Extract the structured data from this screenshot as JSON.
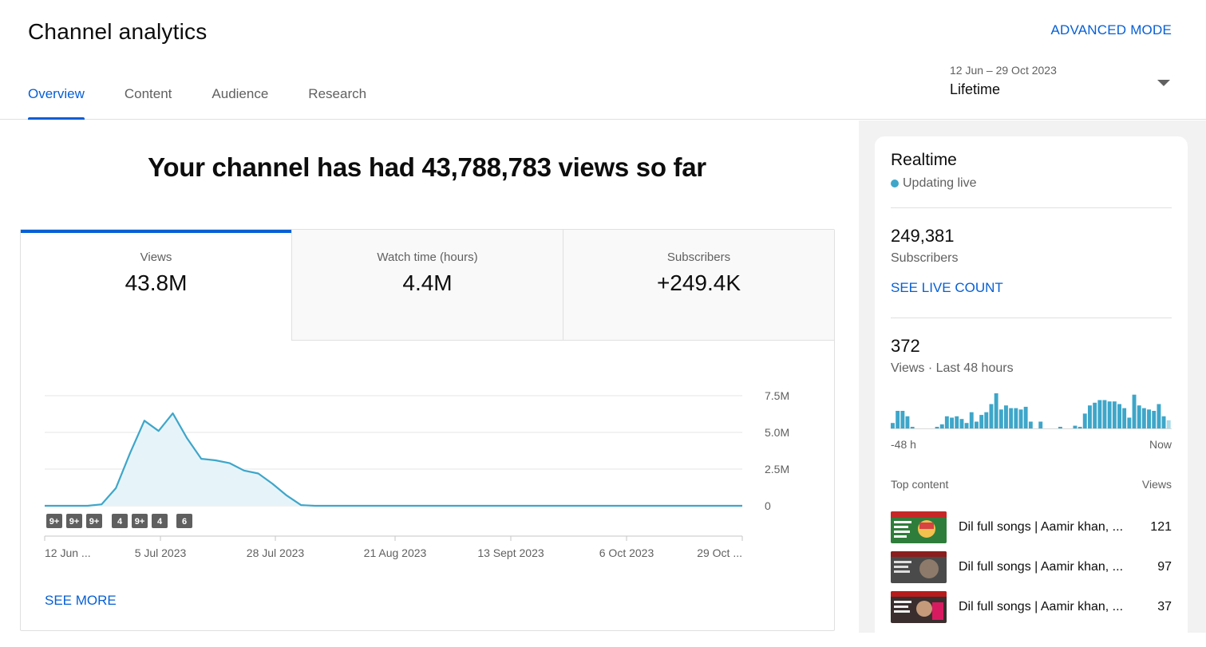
{
  "header": {
    "title": "Channel analytics",
    "advanced_label": "ADVANCED MODE",
    "tabs": [
      {
        "label": "Overview",
        "active": true
      },
      {
        "label": "Content",
        "active": false
      },
      {
        "label": "Audience",
        "active": false
      },
      {
        "label": "Research",
        "active": false
      }
    ],
    "date_picker": {
      "range": "12 Jun – 29 Oct 2023",
      "label": "Lifetime"
    }
  },
  "main": {
    "headline": "Your channel has had 43,788,783 views so far",
    "metrics": [
      {
        "label": "Views",
        "value": "43.8M",
        "active": true
      },
      {
        "label": "Watch time (hours)",
        "value": "4.4M",
        "active": false
      },
      {
        "label": "Subscribers",
        "value": "+249.4K",
        "active": false
      }
    ],
    "see_more": "SEE MORE"
  },
  "chart_data": {
    "type": "area",
    "series": [
      {
        "values": [
          0,
          0,
          0,
          0,
          0.1,
          1.2,
          3.6,
          5.8,
          5.1,
          6.3,
          4.6,
          3.2,
          3.1,
          2.9,
          2.4,
          2.2,
          1.5,
          0.7,
          0.05,
          0,
          0,
          0,
          0,
          0,
          0,
          0,
          0,
          0,
          0,
          0,
          0,
          0,
          0,
          0,
          0,
          0,
          0,
          0,
          0,
          0,
          0,
          0,
          0,
          0,
          0,
          0,
          0,
          0,
          0,
          0
        ]
      }
    ],
    "y_ticks": [
      "7.5M",
      "5.0M",
      "2.5M",
      "0"
    ],
    "ylim": [
      0,
      7.5
    ],
    "x_ticks": [
      "12 Jun ...",
      "5 Jul 2023",
      "28 Jul 2023",
      "21 Aug 2023",
      "13 Sept 2023",
      "6 Oct 2023",
      "29 Oct ..."
    ],
    "markers": [
      "9+",
      "9+",
      "9+",
      "4",
      "9+",
      "4",
      "6"
    ],
    "color": "#3ea6c9",
    "fill_color": "#e6f4fa",
    "grid": true
  },
  "realtime": {
    "title": "Realtime",
    "status": "Updating live",
    "subscribers_count": "249,381",
    "subscribers_label": "Subscribers",
    "live_count_label": "SEE LIVE COUNT",
    "views_count": "372",
    "views_label": "Views · Last 48 hours",
    "axis_left": "-48 h",
    "axis_right": "Now",
    "bars": [
      4,
      13,
      13,
      9,
      1,
      0,
      0,
      0,
      0,
      1,
      3,
      9,
      8,
      9,
      7,
      4,
      12,
      5,
      10,
      12,
      18,
      26,
      14,
      17,
      15,
      15,
      14,
      16,
      5,
      0,
      5,
      0,
      0,
      0,
      1,
      0,
      0,
      2,
      1,
      11,
      17,
      19,
      21,
      21,
      20,
      20,
      18,
      15,
      8,
      25,
      17,
      15,
      14,
      13,
      18,
      9,
      6
    ],
    "top_content_label": "Top content",
    "top_views_label": "Views",
    "top_items": [
      {
        "title": "Dil full songs | Aamir khan, ...",
        "views": "121"
      },
      {
        "title": "Dil full songs | Aamir khan, ...",
        "views": "97"
      },
      {
        "title": "Dil full songs | Aamir khan, ...",
        "views": "37"
      }
    ]
  }
}
